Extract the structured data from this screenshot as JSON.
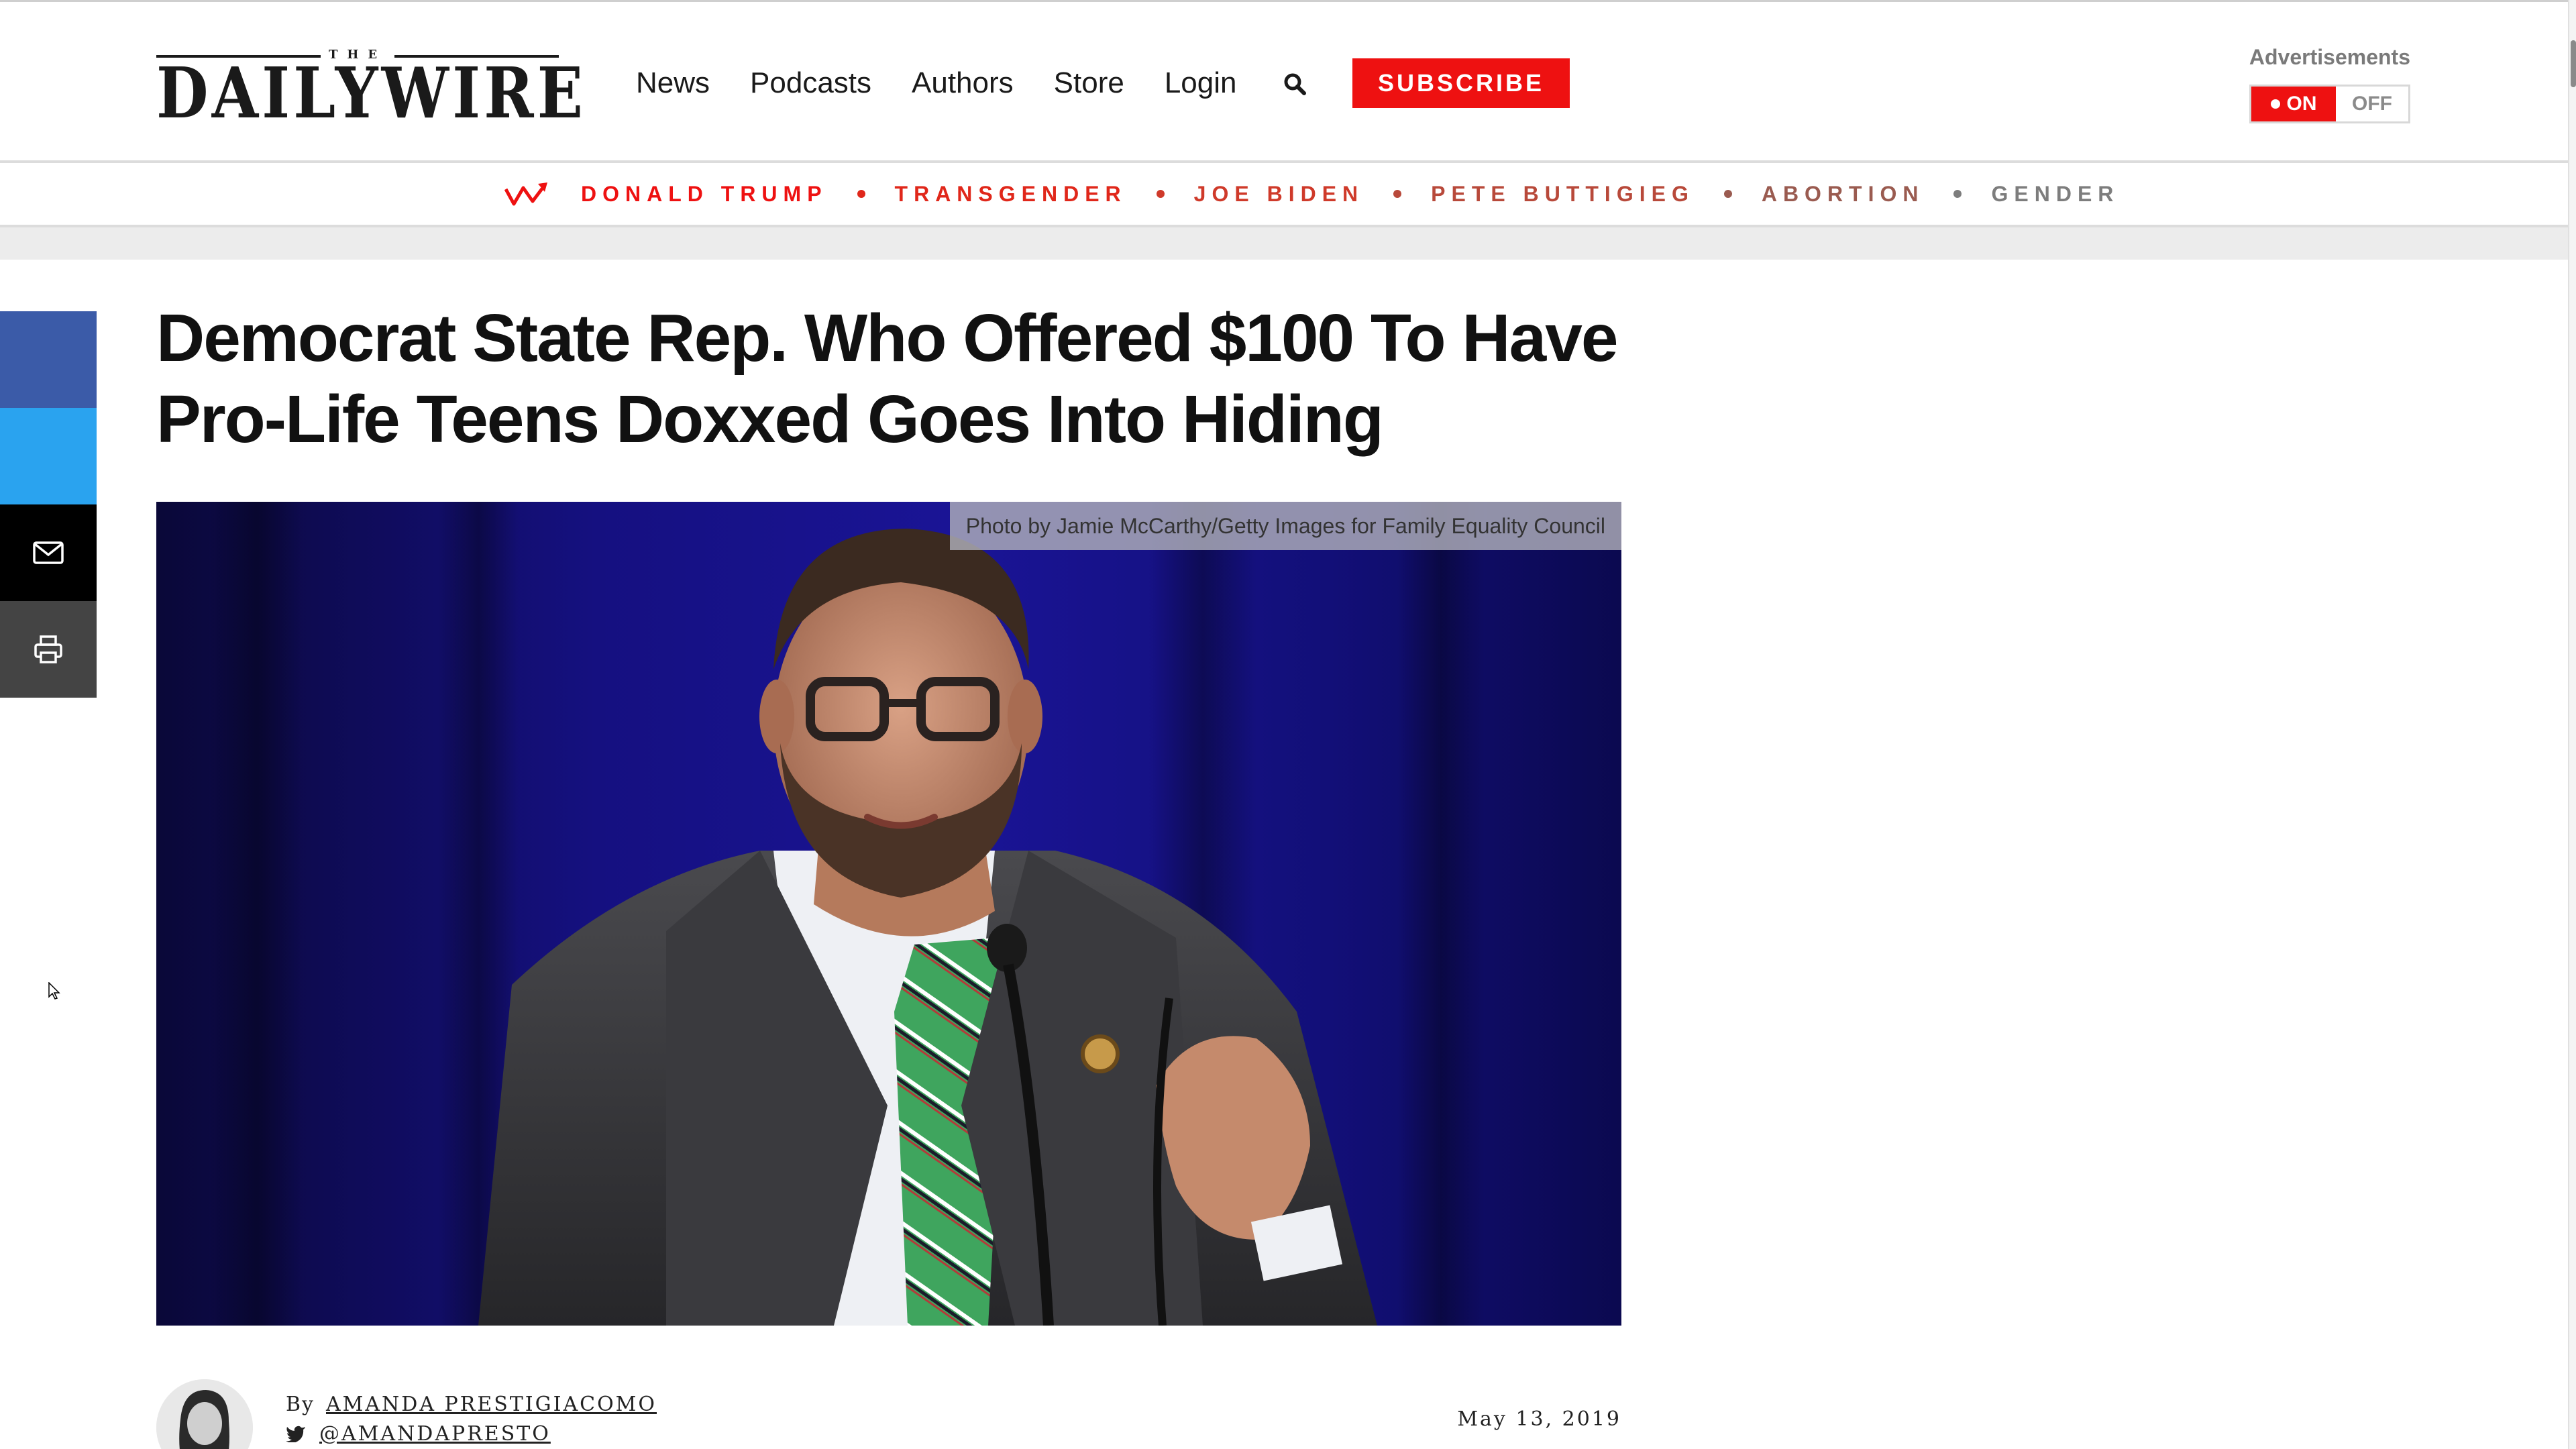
{
  "header": {
    "logo_the": "THE",
    "logo_word": "DAILYWIRE",
    "nav": [
      "News",
      "Podcasts",
      "Authors",
      "Store",
      "Login"
    ],
    "subscribe_label": "SUBSCRIBE",
    "ads": {
      "label": "Advertisements",
      "on": "ON",
      "off": "OFF",
      "state": "on"
    }
  },
  "trending": {
    "items": [
      {
        "label": "DONALD TRUMP",
        "color": "#ee1111"
      },
      {
        "label": "TRANSGENDER",
        "color": "#e0271a"
      },
      {
        "label": "JOE BIDEN",
        "color": "#cf3a2a"
      },
      {
        "label": "PETE BUTTIGIEG",
        "color": "#b8493a"
      },
      {
        "label": "ABORTION",
        "color": "#9a5b50"
      },
      {
        "label": "GENDER",
        "color": "#7d7d7d"
      }
    ]
  },
  "share": [
    {
      "name": "facebook",
      "color": "#3b5ba8",
      "icon": "facebook-icon"
    },
    {
      "name": "twitter",
      "color": "#2aa3ef",
      "icon": "twitter-icon"
    },
    {
      "name": "email",
      "color": "#000000",
      "icon": "envelope-icon"
    },
    {
      "name": "print",
      "color": "#444444",
      "icon": "printer-icon"
    }
  ],
  "article": {
    "headline_line1": "Democrat State Rep. Who Offered $100 To Have",
    "headline_line2": "Pro-Life Teens Doxxed Goes Into Hiding",
    "photo_credit": "Photo by Jamie McCarthy/Getty Images for Family Equality Council",
    "by_label": "By",
    "author": "AMANDA PRESTIGIACOMO",
    "handle": "@AMANDAPRESTO",
    "date": "May 13, 2019"
  },
  "colors": {
    "brand_red": "#ee1111",
    "photo_bg": "#0d0b55"
  }
}
